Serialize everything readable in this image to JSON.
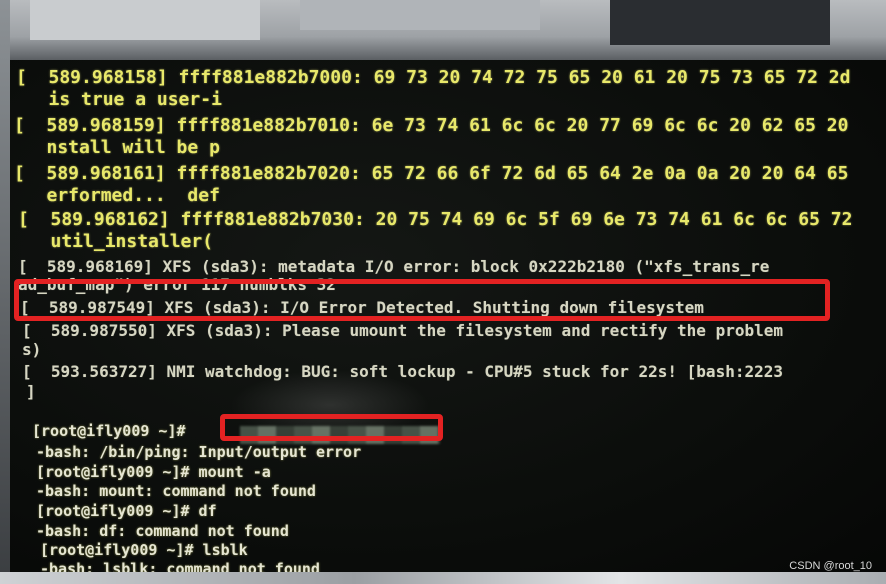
{
  "terminal": {
    "lines": [
      "[  589.968158] ffff881e882b7000: 69 73 20 74 72 75 65 20 61 20 75 73 65 72 2d",
      "   is true a user-i",
      "[  589.968159] ffff881e882b7010: 6e 73 74 61 6c 6c 20 77 69 6c 6c 20 62 65 20",
      "   nstall will be p",
      "[  589.968161] ffff881e882b7020: 65 72 66 6f 72 6d 65 64 2e 0a 0a 20 20 64 65",
      "   erformed...  def",
      "[  589.968162] ffff881e882b7030: 20 75 74 69 6c 5f 69 6e 73 74 61 6c 6c 65 72",
      "   util_installer(",
      "[  589.968169] XFS (sda3): metadata I/O error: block 0x222b2180 (\"xfs_trans_re",
      "ad_buf_map\") error 117 numblks 32",
      "[  589.987549] XFS (sda3): I/O Error Detected. Shutting down filesystem",
      "[  589.987550] XFS (sda3): Please umount the filesystem and rectify the problem",
      "s)",
      "[  593.563727] NMI watchdog: BUG: soft lockup - CPU#5 stuck for 22s! [bash:2223",
      "]",
      "[root@ifly009 ~]# ",
      "-bash: /bin/ping: Input/output error",
      "[root@ifly009 ~]# mount -a",
      "-bash: mount: command not found",
      "[root@ifly009 ~]# df",
      "-bash: df: command not found",
      "[root@ifly009 ~]# lsblk",
      "-bash: lsblk: command not found"
    ]
  },
  "watermark": "CSDN @root_10"
}
